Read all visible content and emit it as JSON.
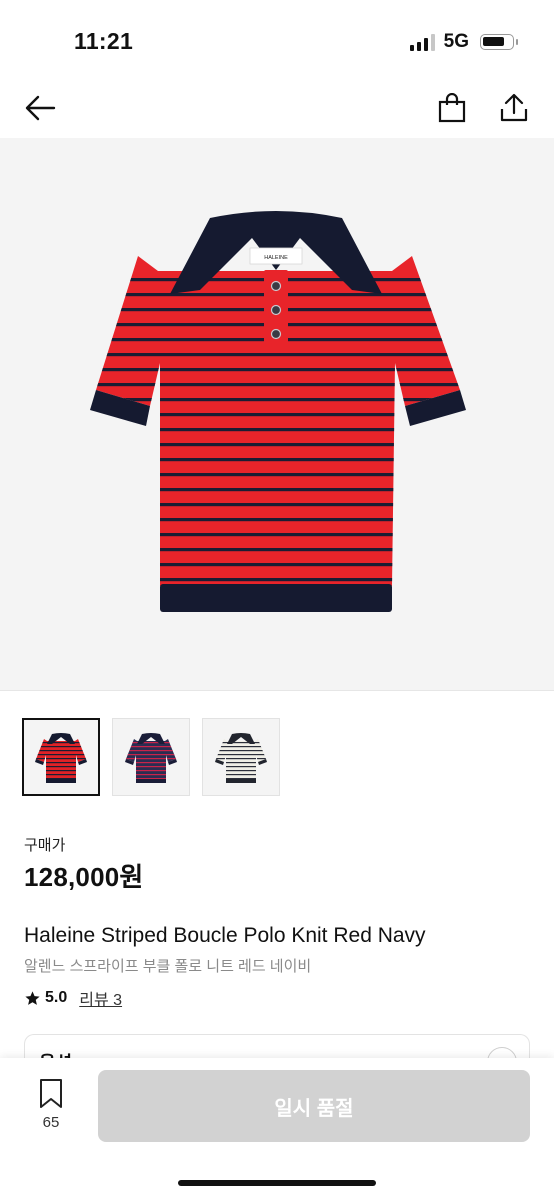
{
  "status_bar": {
    "time": "11:21",
    "network": "5G",
    "signal_bars": 4,
    "signal_bars_active": 3,
    "battery_level": 0.8
  },
  "nav": {
    "back_icon": "arrow-left-icon",
    "bag_icon": "shopping-bag-icon",
    "share_icon": "share-icon"
  },
  "product_image": {
    "brand_label": "HALEINE",
    "body_color": "#e8242a",
    "stripe_color": "#1a1d33",
    "trim_color": "#151a30"
  },
  "thumbnails": [
    {
      "name": "red-navy",
      "body": "#e02226",
      "stripe": "#1a1d33",
      "trim": "#151a30",
      "selected": true
    },
    {
      "name": "navy-red",
      "body": "#2a2d52",
      "stripe": "#c8244a",
      "trim": "#1a1d38",
      "selected": false
    },
    {
      "name": "cream-navy",
      "body": "#efeee6",
      "stripe": "#2b2e3a",
      "trim": "#22252e",
      "selected": false
    }
  ],
  "price": {
    "label": "구매가",
    "value": "128,000원"
  },
  "product": {
    "title_en": "Haleine Striped Boucle Polo Knit Red Navy",
    "title_ko": "알렌느 스프라이프 부클 폴로 니트 레드 네이비"
  },
  "rating": {
    "score": "5.0",
    "review_label": "리뷰 3"
  },
  "options": {
    "label": "옵션"
  },
  "bottom_bar": {
    "bookmark_count": "65",
    "action_label": "일시 품절"
  }
}
